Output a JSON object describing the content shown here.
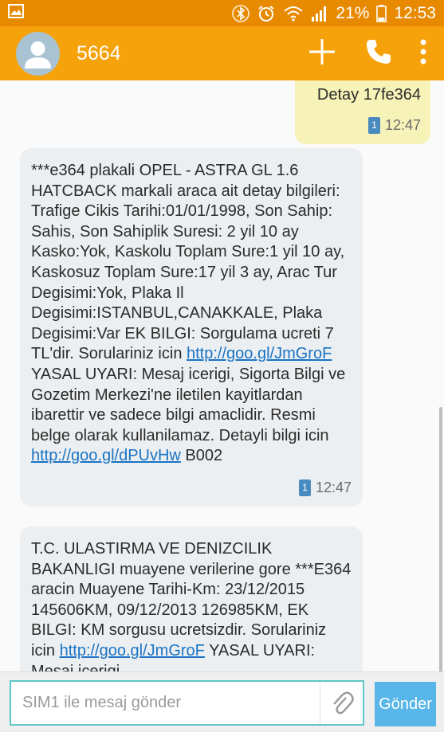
{
  "status_bar": {
    "battery_percent": "21%",
    "time": "12:53",
    "icons": [
      "image-notification-icon",
      "bluetooth-icon",
      "alarm-icon",
      "wifi-icon",
      "signal-icon",
      "battery-icon"
    ]
  },
  "app_bar": {
    "contact_name": "5664",
    "actions": [
      "add-icon",
      "call-icon",
      "more-vertical-icon"
    ]
  },
  "messages": [
    {
      "direction": "outgoing",
      "text": "Detay 17fe364",
      "sim": "1",
      "time": "12:47"
    },
    {
      "direction": "incoming",
      "text_parts": [
        "***e364 plakali OPEL - ASTRA GL 1.6 HATCBACK markali araca ait detay bilgileri: Trafige Cikis Tarihi:01/01/1998, Son Sahip: Sahis, Son Sahiplik Suresi: 2 yil 10 ay Kasko:Yok, Kaskolu Toplam Sure:1 yil 10 ay, Kaskosuz Toplam Sure:17 yil 3 ay, Arac Tur Degisimi:Yok, Plaka Il Degisimi:ISTANBUL,CANAKKALE, Plaka Degisimi:Var EK BILGI: Sorgulama ucreti 7 TL'dir. Sorulariniz icin ",
        "http://goo.gl/JmGroF",
        " YASAL UYARI: Mesaj icerigi, Sigorta Bilgi ve Gozetim Merkezi'ne iletilen kayitlardan ibarettir ve sadece bilgi amaclidir. Resmi belge olarak kullanilamaz. Detayli bilgi icin ",
        "http://goo.gl/dPUvHw",
        " B002"
      ],
      "sim": "1",
      "time": "12:47"
    },
    {
      "direction": "incoming",
      "text_parts": [
        "T.C. ULASTIRMA VE DENIZCILIK BAKANLIGI muayene verilerine gore ***E364 aracin Muayene Tarihi-Km: 23/12/2015 145606KM, 09/12/2013 126985KM, EK BILGI: KM sorgusu ucretsizdir. Sorulariniz icin ",
        "http://goo.gl/JmGroF",
        " YASAL UYARI: Mesaj icerigi"
      ]
    }
  ],
  "composer": {
    "placeholder": "SIM1 ile mesaj gönder",
    "send_label": "Gönder"
  },
  "colors": {
    "status_bar": "#e88a00",
    "app_bar": "#f5a20b",
    "outgoing_bubble": "#f7f3b8",
    "incoming_bubble": "#eceff1",
    "link": "#1a73c4",
    "send_button": "#58b6e8",
    "input_border": "#5fc6c9"
  }
}
